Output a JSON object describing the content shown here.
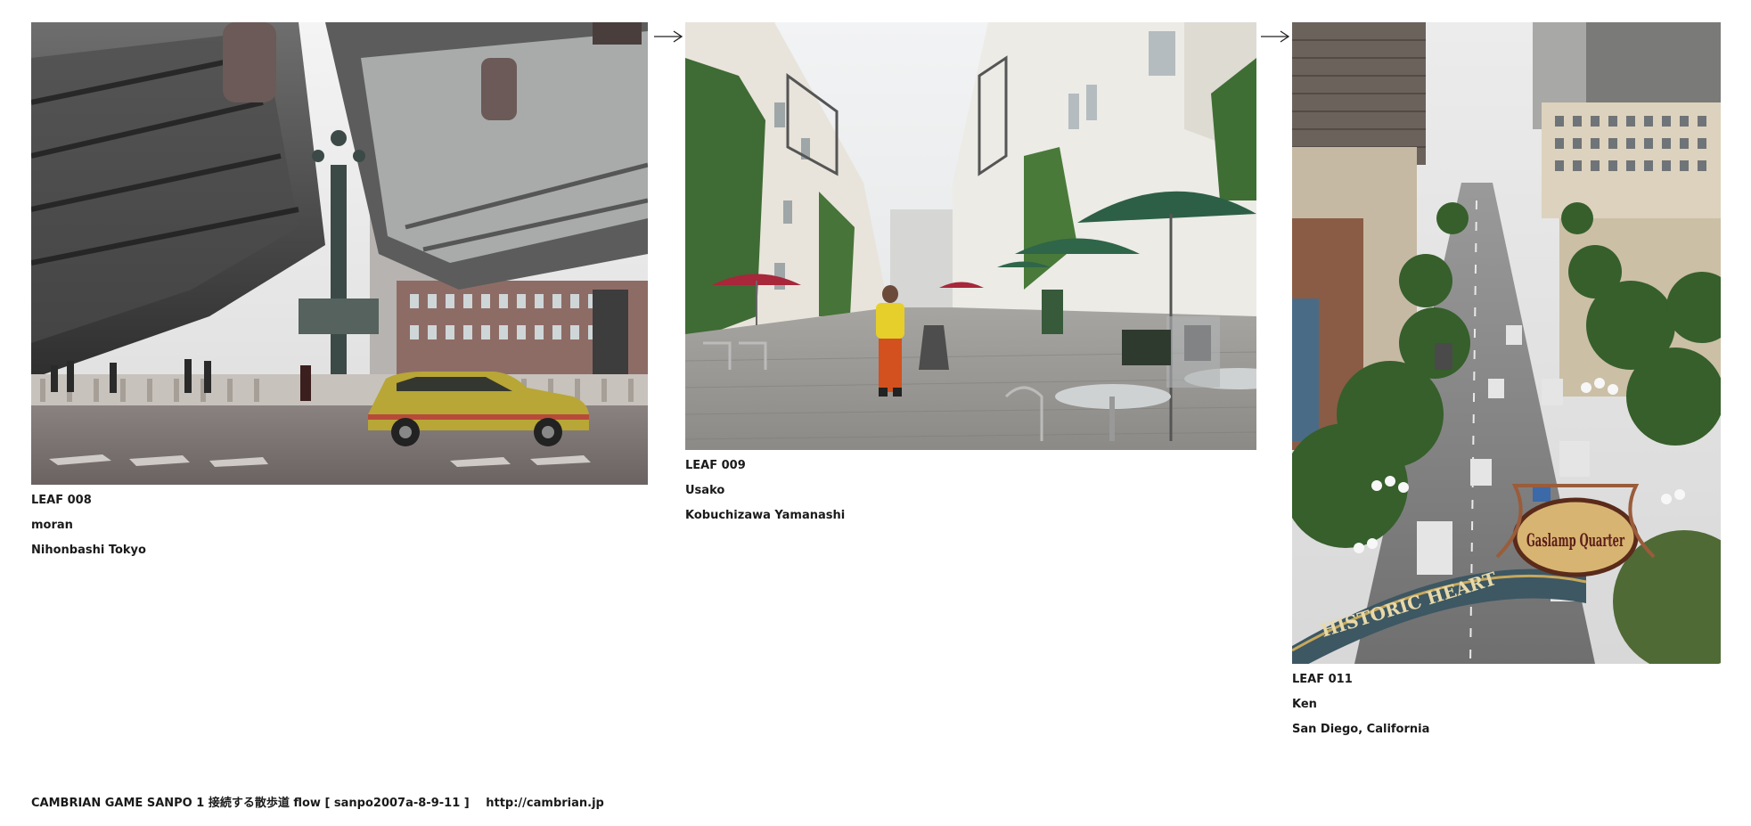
{
  "leaves": [
    {
      "id": "LEAF 008",
      "author": "moran",
      "location": "Nihonbashi Tokyo"
    },
    {
      "id": "LEAF 009",
      "author": "Usako",
      "location": "Kobuchizawa Yamanashi"
    },
    {
      "id": "LEAF 011",
      "author": "Ken",
      "location": "San Diego, California",
      "sign_text": "HISTORIC HEART",
      "sign_logo_text": "Gaslamp Quarter"
    }
  ],
  "footer": {
    "title": "CAMBRIAN GAME  SANPO 1 接続する散歩道 flow [ sanpo2007a-8-9-11 ]",
    "url": "http://cambrian.jp"
  }
}
